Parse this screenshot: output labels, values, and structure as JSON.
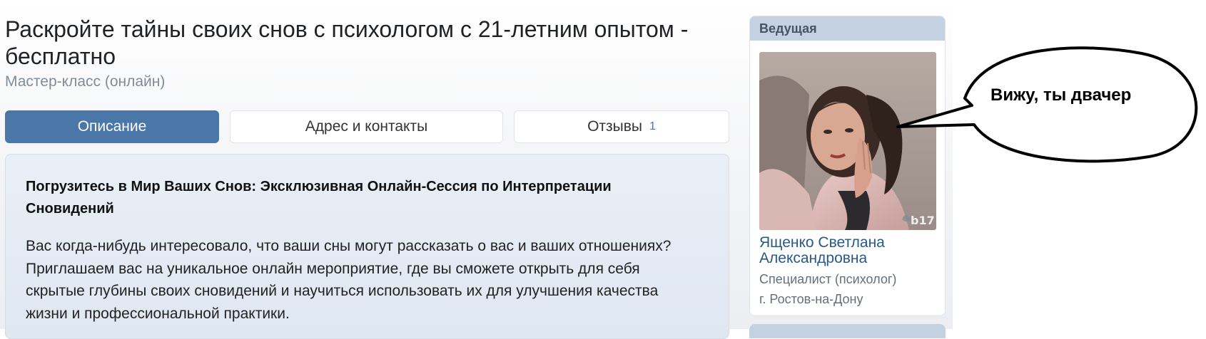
{
  "header": {
    "title": "Раскройте тайны своих снов с психологом с 21-летним опытом - бесплатно",
    "subtitle": "Мастер-класс (онлайн)"
  },
  "tabs": [
    {
      "label": "Описание",
      "active": true
    },
    {
      "label": "Адрес и контакты",
      "active": false
    },
    {
      "label": "Отзывы",
      "count": "1",
      "active": false
    }
  ],
  "content": {
    "heading": "Погрузитесь в Мир Ваших Снов: Эксклюзивная Онлайн-Сессия по Интерпретации Сновидений",
    "paragraph": "Вас когда-нибудь интересовало, что ваши сны могут рассказать о вас и ваших отношениях? Приглашаем вас на уникальное онлайн мероприятие, где вы сможете открыть для себя скрытые глубины своих сновидений и научиться использовать их для улучшения качества жизни и профессиональной практики."
  },
  "host": {
    "header_label": "Ведущая",
    "photo_watermark": "b17",
    "name": "Ященко Светлана Александровна",
    "role": "Специалист (психолог)",
    "city": "г. Ростов-на-Дону"
  },
  "speech_bubble": {
    "text": "Вижу, ты двачер"
  },
  "colors": {
    "accent": "#4a76a8",
    "link": "#2a5885",
    "header_bg": "#c3d1e0",
    "muted": "#818c99"
  }
}
